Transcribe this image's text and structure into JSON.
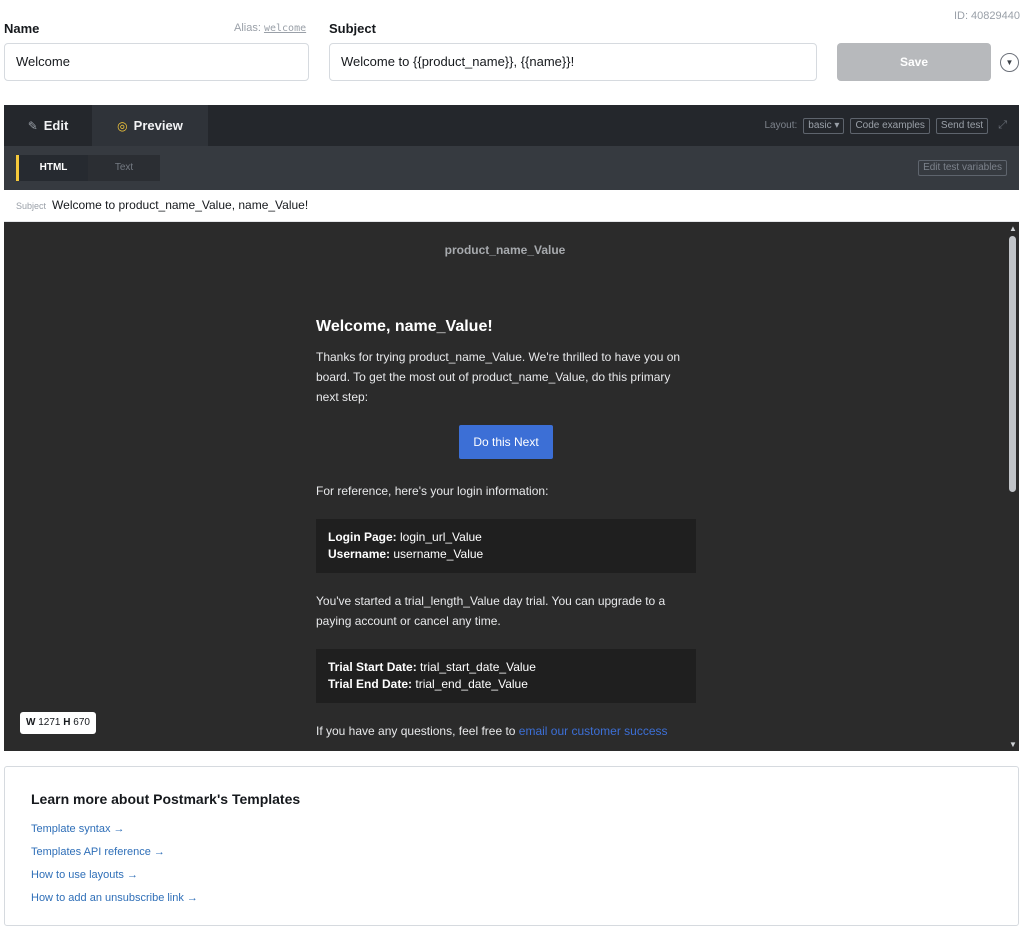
{
  "header": {
    "name_label": "Name",
    "alias_label": "Alias:",
    "alias_value": "welcome",
    "subject_label": "Subject",
    "id_text": "ID: 40829440",
    "name_value": "Welcome",
    "subject_value": "Welcome to {{product_name}}, {{name}}!",
    "save_label": "Save",
    "more_icon": "chevron-down-icon"
  },
  "editor": {
    "tabs": {
      "edit": "Edit",
      "preview": "Preview"
    },
    "layout_label": "Layout:",
    "layout_value": "basic",
    "code_examples": "Code examples",
    "send_test": "Send test",
    "modes": {
      "html": "HTML",
      "text": "Text"
    },
    "edit_test_variables": "Edit test variables",
    "subject_bar_label": "Subject",
    "subject_bar_value": "Welcome to product_name_Value, name_Value!"
  },
  "email": {
    "brand": "product_name_Value",
    "heading": "Welcome, name_Value!",
    "intro": "Thanks for trying product_name_Value. We're thrilled to have you on board. To get the most out of product_name_Value, do this primary next step:",
    "cta": "Do this Next",
    "reference": "For reference, here's your login information:",
    "login_page_label": "Login Page:",
    "login_page_value": " login_url_Value",
    "username_label": "Username:",
    "username_value": " username_Value",
    "trial_text": "You've started a trial_length_Value day trial. You can upgrade to a paying account or cancel any time.",
    "trial_start_label": "Trial Start Date:",
    "trial_start_value": " trial_start_date_Value",
    "trial_end_label": "Trial End Date:",
    "trial_end_value": " trial_end_date_Value",
    "questions_text": "If you have any questions, feel free to ",
    "questions_link": "email our customer success"
  },
  "viewport": {
    "w_label": "W",
    "w_value": "1271",
    "h_label": "H",
    "h_value": "670"
  },
  "learn": {
    "title": "Learn more about Postmark's Templates",
    "links": [
      "Template syntax →",
      "Templates API reference →",
      "How to use layouts →",
      "How to add an unsubscribe link →"
    ]
  }
}
